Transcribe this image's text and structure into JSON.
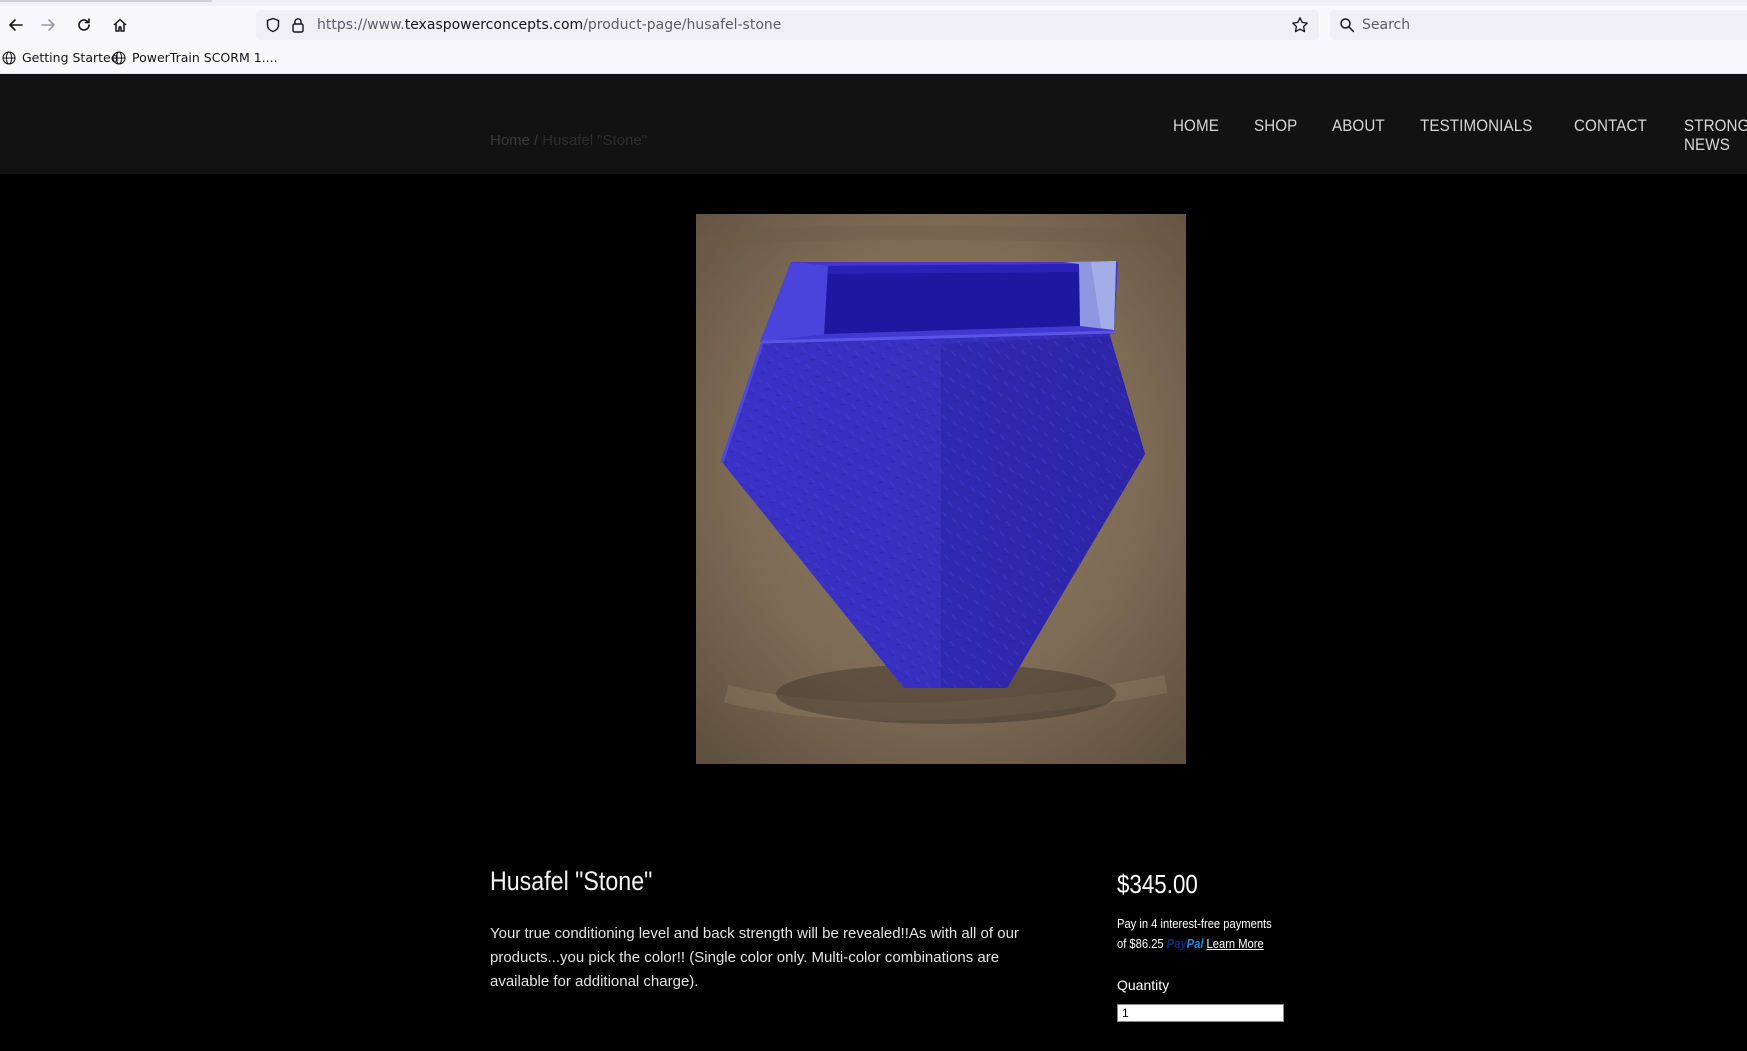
{
  "browser": {
    "url_prefix": "https://www.",
    "url_domain": "texaspowerconcepts.com",
    "url_path": "/product-page/husafel-stone",
    "search_placeholder": "Search",
    "bookmarks": [
      {
        "label": "Getting Started"
      },
      {
        "label": "PowerTrain SCORM 1...."
      }
    ]
  },
  "site": {
    "breadcrumb": {
      "home": "Home",
      "separator": "/",
      "current": "Husafel \"Stone\""
    },
    "menu": [
      "HOME",
      "SHOP",
      "ABOUT",
      "TESTIMONIALS",
      "CONTACT",
      "STRONGMAN NEWS"
    ]
  },
  "product": {
    "title": "Husafel \"Stone\"",
    "description": "Your true conditioning level and back strength will be revealed!!As with all of our products...you pick the color!! (Single color only. Multi-color combinations are available for additional charge).",
    "price": "$345.00",
    "paypal_line1": "Pay in 4 interest-free payments",
    "paypal_line2_prefix": "of $86.25",
    "paypal_logo_pay": "Pay",
    "paypal_logo_pal": "Pal",
    "paypal_learn_more": "Learn More",
    "quantity_label": "Quantity",
    "quantity_value": "1",
    "image_color": "#3a33c9"
  }
}
